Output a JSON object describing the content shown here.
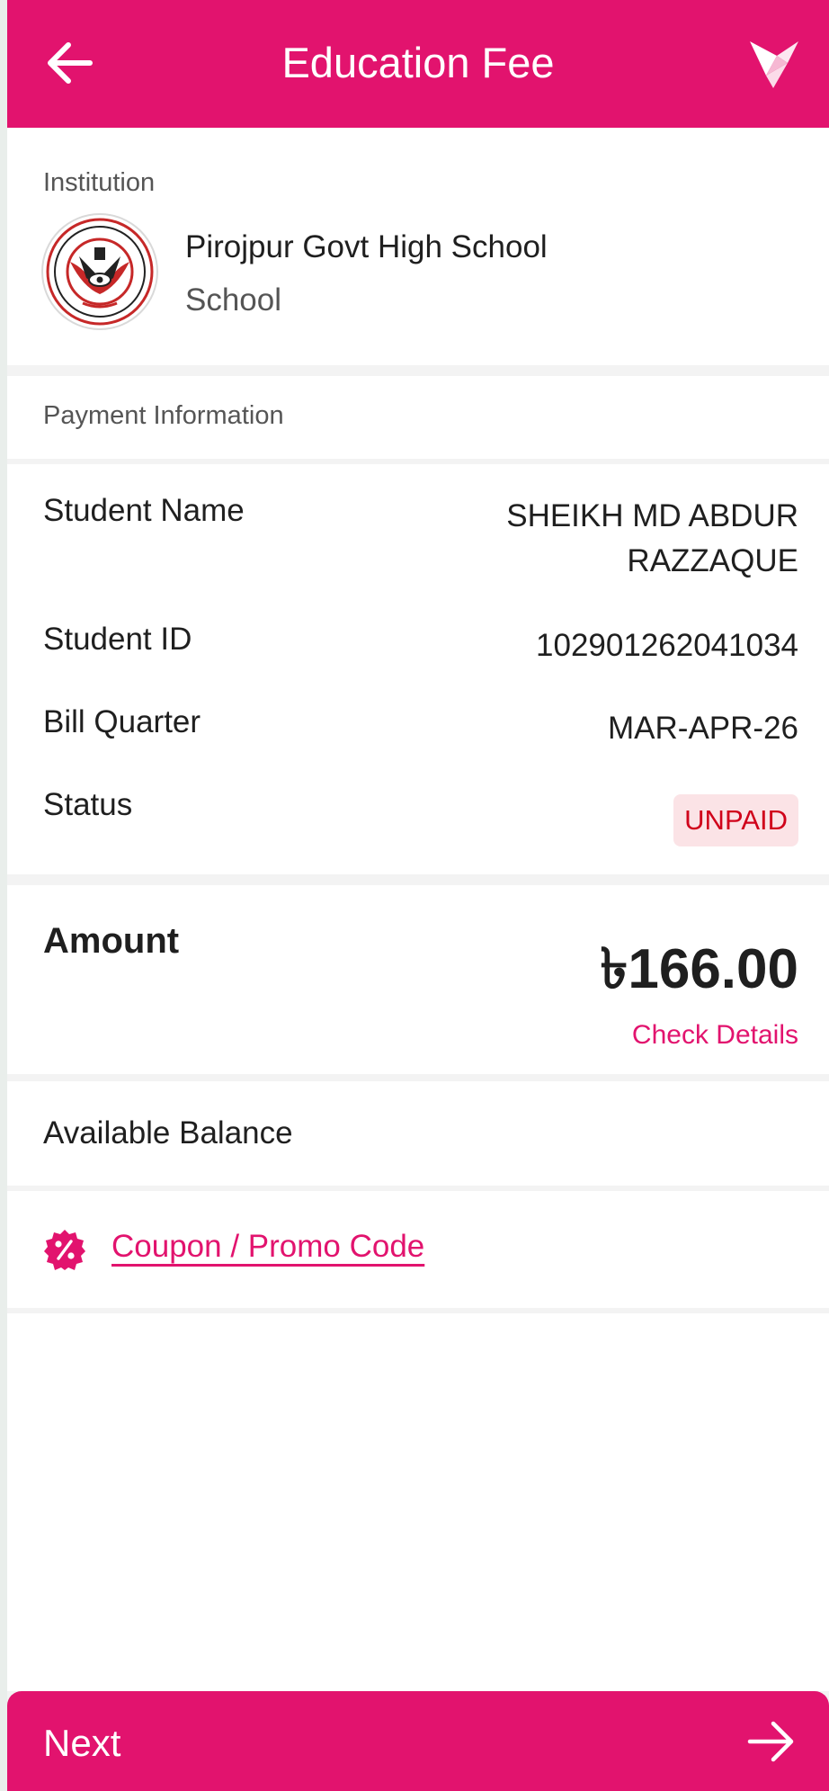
{
  "header": {
    "title": "Education Fee",
    "back_icon": "arrow-left-icon",
    "logo_icon": "bkash-bird-logo"
  },
  "institution": {
    "section_label": "Institution",
    "name": "Pirojpur Govt High School",
    "type": "School",
    "logo_icon": "school-crest-logo"
  },
  "payment_info": {
    "section_label": "Payment Information",
    "rows": [
      {
        "label": "Student Name",
        "value": "SHEIKH MD ABDUR RAZZAQUE"
      },
      {
        "label": "Student ID",
        "value": "102901262041034"
      },
      {
        "label": "Bill Quarter",
        "value": "MAR-APR-26"
      },
      {
        "label": "Status",
        "value": "UNPAID"
      }
    ]
  },
  "amount": {
    "label": "Amount",
    "value": "৳166.00",
    "details_link": "Check Details"
  },
  "balance": {
    "label": "Available Balance"
  },
  "coupon": {
    "label": "Coupon / Promo Code",
    "icon": "discount-badge-icon"
  },
  "footer": {
    "next_label": "Next",
    "next_icon": "arrow-right-icon"
  },
  "colors": {
    "brand": "#e2136e",
    "status_unpaid_text": "#d0021b",
    "status_unpaid_bg": "#fbe3e6"
  }
}
